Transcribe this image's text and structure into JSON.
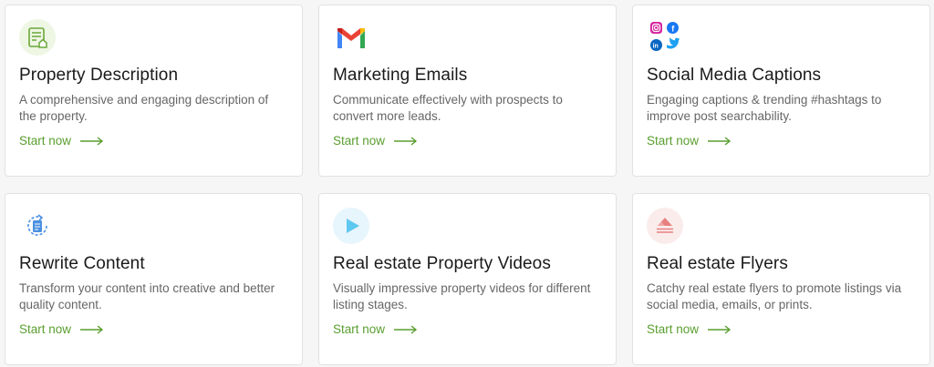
{
  "cards": [
    {
      "title": "Property Description",
      "description": "A comprehensive and engaging description of the property.",
      "cta": "Start now",
      "icon": "document-house-icon"
    },
    {
      "title": "Marketing Emails",
      "description": "Communicate effectively with prospects to convert more leads.",
      "cta": "Start now",
      "icon": "gmail-icon"
    },
    {
      "title": "Social Media Captions",
      "description": "Engaging captions & trending #hashtags to improve post searchability.",
      "cta": "Start now",
      "icon": "social-media-icons"
    },
    {
      "title": "Rewrite Content",
      "description": "Transform your content into creative and better quality content.",
      "cta": "Start now",
      "icon": "rewrite-icon"
    },
    {
      "title": "Real estate Property Videos",
      "description": "Visually impressive property videos for different listing stages.",
      "cta": "Start now",
      "icon": "play-video-icon"
    },
    {
      "title": "Real estate Flyers",
      "description": "Catchy real estate flyers to promote listings via social media, emails, or prints.",
      "cta": "Start now",
      "icon": "flyer-icon"
    }
  ],
  "colors": {
    "accent_green": "#5a9e2f",
    "title_text": "#1a1a1a",
    "body_text": "#666666"
  }
}
